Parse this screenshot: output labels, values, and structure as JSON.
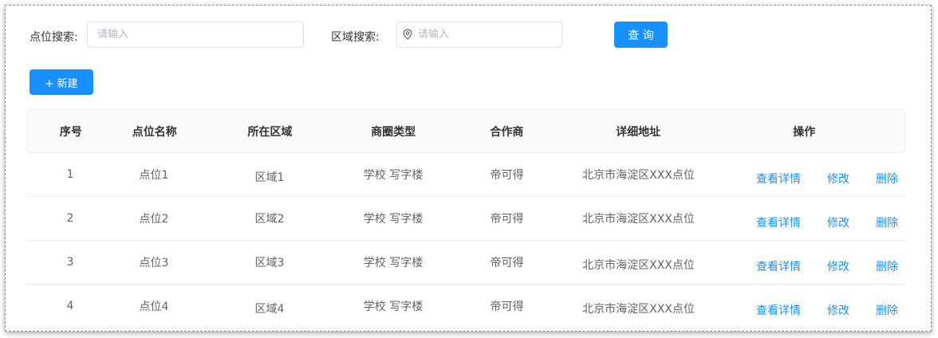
{
  "search": {
    "point_label": "点位搜索:",
    "point_placeholder": "请输入",
    "area_label": "区域搜索:",
    "area_placeholder": "请输入",
    "query_label": "查 询"
  },
  "toolbar": {
    "new_label": "+ 新建"
  },
  "table": {
    "headers": [
      "序号",
      "点位名称",
      "所在区域",
      "商圈类型",
      "合作商",
      "详细地址",
      "操作"
    ],
    "rows": [
      {
        "idx": "1",
        "name": "点位1",
        "area": "区域1",
        "type": "学校 写字楼",
        "partner": "帝可得",
        "address": "北京市海淀区XXX点位"
      },
      {
        "idx": "2",
        "name": "点位2",
        "area": "区域2",
        "type": "学校 写字楼",
        "partner": "帝可得",
        "address": "北京市海淀区XXX点位"
      },
      {
        "idx": "3",
        "name": "点位3",
        "area": "区域3",
        "type": "学校 写字楼",
        "partner": "帝可得",
        "address": "北京市海淀区XXX点位"
      },
      {
        "idx": "4",
        "name": "点位4",
        "area": "区域4",
        "type": "学校 写字楼",
        "partner": "帝可得",
        "address": "北京市海淀区XXX点位"
      }
    ],
    "actions": {
      "view": "查看详情",
      "edit": "修改",
      "delete": "删除"
    }
  },
  "colors": {
    "primary": "#1890ff",
    "border": "#dcdfe6",
    "header_bg": "#fafafa"
  },
  "icons": {
    "area_input": "location-pin-icon"
  }
}
